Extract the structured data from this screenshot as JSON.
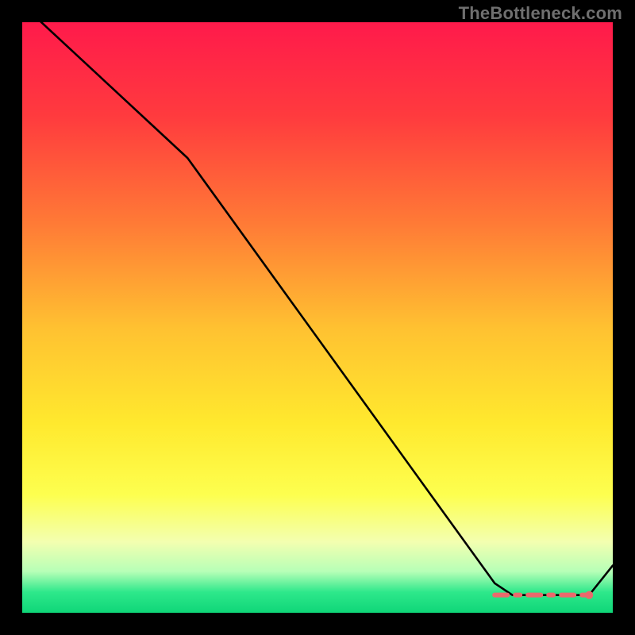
{
  "watermark": "TheBottleneck.com",
  "chart_data": {
    "type": "line",
    "title": "",
    "xlabel": "",
    "ylabel": "",
    "xlim": [
      0,
      100
    ],
    "ylim": [
      0,
      100
    ],
    "grid": false,
    "series": [
      {
        "name": "curve",
        "color": "#000000",
        "x": [
          0,
          28,
          80,
          83,
          93,
          96,
          100
        ],
        "y": [
          103,
          77,
          5,
          3,
          3,
          3,
          8
        ]
      }
    ],
    "markers": [
      {
        "name": "flat-segment",
        "color": "#ea6a6c",
        "width": 6,
        "x": [
          80,
          83,
          93,
          96
        ],
        "y": [
          3,
          3,
          3,
          3
        ]
      },
      {
        "name": "end-dot",
        "color": "#ea6a6c",
        "r": 5,
        "x": 96,
        "y": 3
      }
    ],
    "background_gradient": {
      "stops": [
        {
          "offset": 0.0,
          "color": "#ff1a4b"
        },
        {
          "offset": 0.16,
          "color": "#ff3b3e"
        },
        {
          "offset": 0.34,
          "color": "#ff7a36"
        },
        {
          "offset": 0.52,
          "color": "#ffc231"
        },
        {
          "offset": 0.68,
          "color": "#ffe92e"
        },
        {
          "offset": 0.8,
          "color": "#fdff4f"
        },
        {
          "offset": 0.88,
          "color": "#f3ffb0"
        },
        {
          "offset": 0.93,
          "color": "#b7ffb7"
        },
        {
          "offset": 0.965,
          "color": "#2ee88b"
        },
        {
          "offset": 1.0,
          "color": "#0fd678"
        }
      ]
    }
  }
}
